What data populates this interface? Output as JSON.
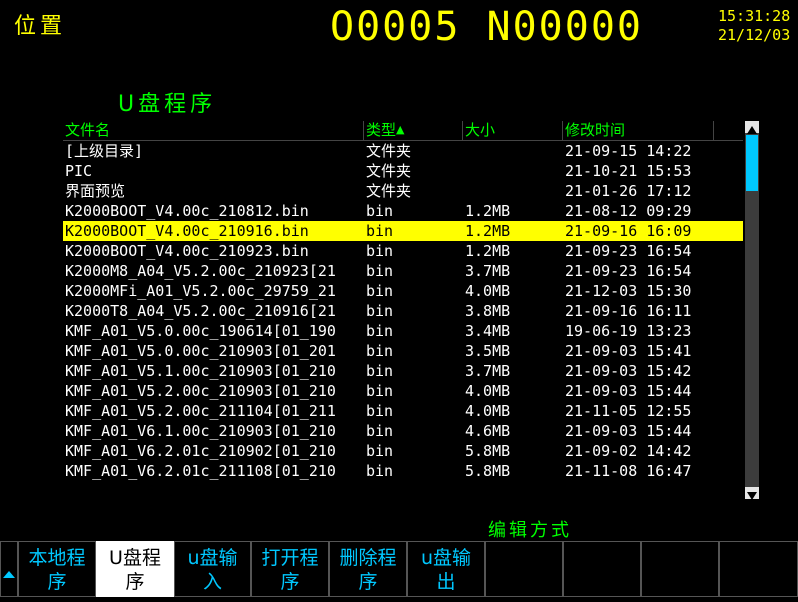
{
  "header": {
    "mode_title": "位置",
    "program_number": "O0005 N00000",
    "time": "15:31:28",
    "date": "21/12/03"
  },
  "section_title": "U盘程序",
  "file_list": {
    "columns": {
      "name": "文件名",
      "type": "类型",
      "sort_indicator": "▲",
      "size": "大小",
      "modified": "修改时间"
    },
    "rows": [
      {
        "name": "[上级目录]",
        "type": "文件夹",
        "size": "",
        "modified": "21-09-15 14:22"
      },
      {
        "name": "PIC",
        "type": "文件夹",
        "size": "",
        "modified": "21-10-21 15:53"
      },
      {
        "name": "界面预览",
        "type": "文件夹",
        "size": "",
        "modified": "21-01-26 17:12"
      },
      {
        "name": "K2000BOOT_V4.00c_210812.bin",
        "type": " bin",
        "size": " 1.2MB",
        "modified": "21-08-12 09:29"
      },
      {
        "name": "K2000BOOT_V4.00c_210916.bin",
        "type": " bin",
        "size": " 1.2MB",
        "modified": "21-09-16 16:09"
      },
      {
        "name": "K2000BOOT_V4.00c_210923.bin",
        "type": " bin",
        "size": " 1.2MB",
        "modified": "21-09-23 16:54"
      },
      {
        "name": "K2000M8_A04_V5.2.00c_210923[21",
        "type": " bin",
        "size": " 3.7MB",
        "modified": "21-09-23 16:54"
      },
      {
        "name": "K2000MFi_A01_V5.2.00c_29759_21",
        "type": " bin",
        "size": " 4.0MB",
        "modified": "21-12-03 15:30"
      },
      {
        "name": "K2000T8_A04_V5.2.00c_210916[21",
        "type": " bin",
        "size": " 3.8MB",
        "modified": "21-09-16 16:11"
      },
      {
        "name": "KMF_A01_V5.0.00c_190614[01_190",
        "type": " bin",
        "size": " 3.4MB",
        "modified": "19-06-19 13:23"
      },
      {
        "name": "KMF_A01_V5.0.00c_210903[01_201",
        "type": " bin",
        "size": " 3.5MB",
        "modified": "21-09-03 15:41"
      },
      {
        "name": "KMF_A01_V5.1.00c_210903[01_210",
        "type": " bin",
        "size": " 3.7MB",
        "modified": "21-09-03 15:42"
      },
      {
        "name": "KMF_A01_V5.2.00c_210903[01_210",
        "type": " bin",
        "size": " 4.0MB",
        "modified": "21-09-03 15:44"
      },
      {
        "name": "KMF_A01_V5.2.00c_211104[01_211",
        "type": " bin",
        "size": " 4.0MB",
        "modified": "21-11-05 12:55"
      },
      {
        "name": "KMF_A01_V6.1.00c_210903[01_210",
        "type": " bin",
        "size": " 4.6MB",
        "modified": "21-09-03 15:44"
      },
      {
        "name": "KMF_A01_V6.2.01c_210902[01_210",
        "type": " bin",
        "size": " 5.8MB",
        "modified": "21-09-02 14:42"
      },
      {
        "name": "KMF_A01_V6.2.01c_211108[01_210",
        "type": " bin",
        "size": " 5.8MB",
        "modified": "21-11-08 16:47"
      }
    ],
    "selected_index": 4
  },
  "status": {
    "edit_mode": "编辑方式"
  },
  "softkeys": [
    {
      "line1": "本地程",
      "line2": "序",
      "active": false
    },
    {
      "line1": "U盘程",
      "line2": "序",
      "active": true
    },
    {
      "line1": "u盘输",
      "line2": "入",
      "active": false
    },
    {
      "line1": "打开程",
      "line2": "序",
      "active": false
    },
    {
      "line1": "删除程",
      "line2": "序",
      "active": false
    },
    {
      "line1": "u盘输",
      "line2": "出",
      "active": false
    },
    {
      "line1": "",
      "line2": "",
      "active": false
    },
    {
      "line1": "",
      "line2": "",
      "active": false
    },
    {
      "line1": "",
      "line2": "",
      "active": false
    },
    {
      "line1": "",
      "line2": "",
      "active": false
    }
  ],
  "colors": {
    "header_yellow": "#ffff00",
    "title_green": "#00ff00",
    "softkey_cyan": "#00c8ff",
    "selection": "#ffff00"
  }
}
